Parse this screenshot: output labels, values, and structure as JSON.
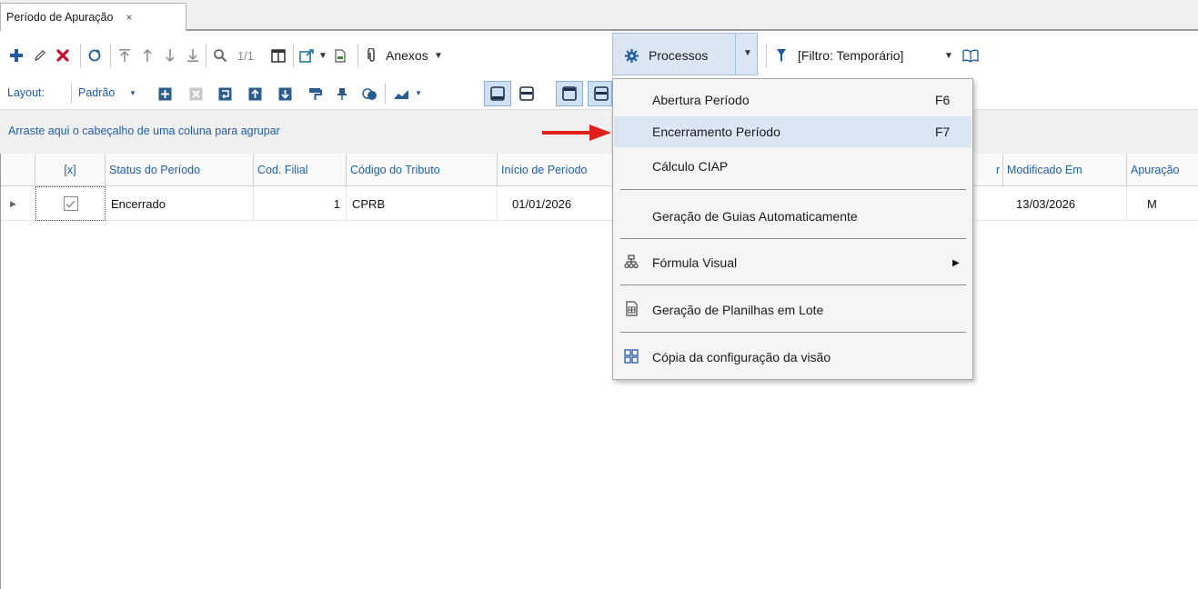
{
  "tab": {
    "title": "Período de Apuração",
    "close": "×"
  },
  "toolbar": {
    "record_count": "1/1",
    "anexos_label": "Anexos",
    "processos_label": "Processos",
    "filter_label": "[Filtro: Temporário]"
  },
  "layout_bar": {
    "label": "Layout:",
    "preset": "Padrão"
  },
  "group_panel": {
    "hint": "Arraste aqui o cabeçalho de uma coluna para agrupar"
  },
  "grid": {
    "columns": [
      "[x]",
      "Status do Período",
      "Cod. Filial",
      "Código do Tributo",
      "Início de Período",
      "r",
      "Modificado Em",
      "Apuração"
    ],
    "rows": [
      {
        "status": "Encerrado",
        "filial": "1",
        "tributo": "CPRB",
        "inicio": "01/01/2026",
        "modificado": "13/03/2026",
        "apuracao": "M"
      }
    ]
  },
  "menu": {
    "items": [
      {
        "label": "Abertura Período",
        "shortcut": "F6"
      },
      {
        "label": "Encerramento Período",
        "shortcut": "F7"
      },
      {
        "label": "Cálculo CIAP"
      },
      {
        "label": "Geração de Guias Automaticamente"
      },
      {
        "label": "Fórmula Visual"
      },
      {
        "label": "Geração de Planilhas em Lote"
      },
      {
        "label": "Cópia da configuração da visão"
      }
    ]
  },
  "colors": {
    "accent": "#1f5ea8",
    "highlight": "#dbe6f4",
    "annotation_arrow": "#e0201b"
  }
}
